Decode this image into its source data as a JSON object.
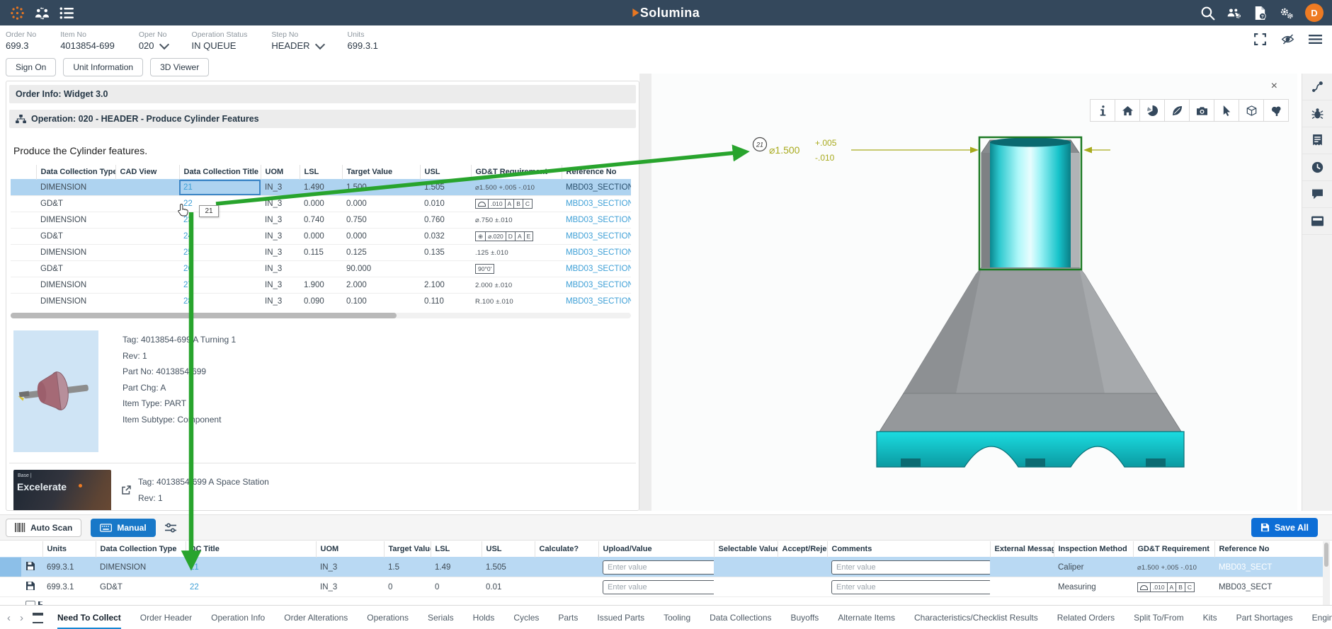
{
  "topbar": {
    "logo_text": "Solumina",
    "avatar_initial": "D",
    "left_icons": [
      "app-launcher-icon",
      "handoff-icon",
      "task-list-icon"
    ],
    "right_icons": [
      "search-icon",
      "user-admin-icon",
      "help-doc-icon",
      "settings-gears-icon"
    ]
  },
  "context_bar": {
    "fields": [
      {
        "label": "Order No",
        "value": "699.3",
        "dropdown": false
      },
      {
        "label": "Item No",
        "value": "4013854-699",
        "dropdown": false
      },
      {
        "label": "Oper No",
        "value": "020",
        "dropdown": true
      },
      {
        "label": "Operation Status",
        "value": "IN QUEUE",
        "dropdown": false
      },
      {
        "label": "Step No",
        "value": "HEADER",
        "dropdown": true
      },
      {
        "label": "Units",
        "value": "699.3.1",
        "dropdown": false
      }
    ],
    "right_icons": [
      "fullscreen-icon",
      "eye-off-icon",
      "menu-icon"
    ]
  },
  "action_buttons": [
    "Sign On",
    "Unit Information",
    "3D Viewer"
  ],
  "left_panel": {
    "order_info_title": "Order Info: Widget 3.0",
    "operation_title": "Operation: 020 - HEADER - Produce Cylinder Features",
    "instruction": "Produce the Cylinder features.",
    "collect_table": {
      "columns": [
        "Data Collection Type",
        "CAD View",
        "Data Collection Title",
        "UOM",
        "LSL",
        "Target Value",
        "USL",
        "GD&T Requirement",
        "Reference No"
      ],
      "rows": [
        {
          "type": "DIMENSION",
          "title": "21",
          "uom": "IN_3",
          "lsl": "1.490",
          "target": "1.500",
          "usl": "1.505",
          "gdt": {
            "text": "⌀1.500  +.005  -.010"
          },
          "ref": "MBD03_SECTION",
          "selected": true
        },
        {
          "type": "GD&T",
          "title": "22",
          "uom": "IN_3",
          "lsl": "0.000",
          "target": "0.000",
          "usl": "0.010",
          "gdt": {
            "frame": [
              "profile-of-surface-symbol",
              ".010",
              "A",
              "B",
              "C"
            ]
          },
          "ref": "MBD03_SECTION",
          "selected": false
        },
        {
          "type": "DIMENSION",
          "title": "23",
          "uom": "IN_3",
          "lsl": "0.740",
          "target": "0.750",
          "usl": "0.760",
          "gdt": {
            "text": "⌀.750  ±.010"
          },
          "ref": "MBD03_SECTION",
          "selected": false
        },
        {
          "type": "GD&T",
          "title": "24",
          "uom": "IN_3",
          "lsl": "0.000",
          "target": "0.000",
          "usl": "0.032",
          "gdt": {
            "frame": [
              "⊕",
              "⌀.020",
              "D",
              "A",
              "E"
            ]
          },
          "ref": "MBD03_SECTION",
          "selected": false
        },
        {
          "type": "DIMENSION",
          "title": "25",
          "uom": "IN_3",
          "lsl": "0.115",
          "target": "0.125",
          "usl": "0.135",
          "gdt": {
            "text": ".125  ±.010"
          },
          "ref": "MBD03_SECTION",
          "selected": false
        },
        {
          "type": "GD&T",
          "title": "26",
          "uom": "IN_3",
          "lsl": "",
          "target": "90.000",
          "usl": "",
          "gdt": {
            "frame": [
              "90°0'"
            ]
          },
          "ref": "MBD03_SECTION",
          "selected": false
        },
        {
          "type": "DIMENSION",
          "title": "27",
          "uom": "IN_3",
          "lsl": "1.900",
          "target": "2.000",
          "usl": "2.100",
          "gdt": {
            "text": "2.000  ±.010"
          },
          "ref": "MBD03_SECTION",
          "selected": false
        },
        {
          "type": "DIMENSION",
          "title": "28",
          "uom": "IN_3",
          "lsl": "0.090",
          "target": "0.100",
          "usl": "0.110",
          "gdt": {
            "text": "R.100  ±.010"
          },
          "ref": "MBD03_SECTION",
          "selected": false
        }
      ]
    },
    "item_card": {
      "lines": [
        "Tag: 4013854-699 A Turning 1",
        "Rev: 1",
        "Part No: 4013854-699",
        "Part Chg: A",
        "Item Type: PART",
        "Item Subtype: Component"
      ]
    },
    "item_card_2": {
      "tag": "Tag: 4013854-699 A Space Station",
      "rev": "Rev: 1",
      "thumb_brand_small": "Base |",
      "thumb_brand": "Excelerate"
    }
  },
  "viewer": {
    "toolbar_icons": [
      "info-icon",
      "home-icon",
      "pie-section-icon",
      "feather-markup-icon",
      "camera-snapshot-icon",
      "select-cursor-icon",
      "cube-model-icon",
      "model-tree-icon"
    ],
    "close_glyph": "×",
    "annotation": {
      "balloon": "21",
      "dimension": "⌀1.500",
      "tol_plus": "+.005",
      "tol_minus": "-.010"
    }
  },
  "right_sidebar_icons": [
    "route-icon",
    "bug-icon",
    "receipt-icon",
    "history-clock-icon",
    "comments-icon",
    "card-panel-icon"
  ],
  "scan_bar": {
    "auto_scan_label": "Auto Scan",
    "manual_label": "Manual",
    "save_all_label": "Save All"
  },
  "entry_table": {
    "columns": [
      "Units",
      "Data Collection Type",
      "DC Title",
      "UOM",
      "Target Value",
      "LSL",
      "USL",
      "Calculate?",
      "Upload/Value",
      "Selectable Value",
      "Accept/Reject",
      "Comments",
      "External Message",
      "Inspection Method",
      "GD&T Requirement",
      "Reference No"
    ],
    "input_placeholder": "Enter value",
    "rows": [
      {
        "units": "699.3.1",
        "type": "DIMENSION",
        "title": "21",
        "uom": "IN_3",
        "target": "1.5",
        "lsl": "1.49",
        "usl": "1.505",
        "method": "Caliper",
        "gdt": {
          "text": "⌀1.500  +.005  -.010"
        },
        "ref": "MBD03_SECT",
        "selected": true
      },
      {
        "units": "699.3.1",
        "type": "GD&T",
        "title": "22",
        "uom": "IN_3",
        "target": "0",
        "lsl": "0",
        "usl": "0.01",
        "method": "Measuring",
        "gdt": {
          "frame": [
            "profile-of-surface-symbol",
            ".010",
            "A",
            "B",
            "C"
          ]
        },
        "ref": "MBD03_SECT",
        "selected": false
      }
    ]
  },
  "tabs": {
    "active": "Need To Collect",
    "items": [
      "Need To Collect",
      "Order Header",
      "Operation Info",
      "Order Alterations",
      "Operations",
      "Serials",
      "Holds",
      "Cycles",
      "Parts",
      "Issued Parts",
      "Tooling",
      "Data Collections",
      "Buyoffs",
      "Alternate Items",
      "Characteristics/Checklist Results",
      "Related Orders",
      "Split To/From",
      "Kits",
      "Part Shortages",
      "Engineering Standards"
    ]
  },
  "annotations": {
    "tooltip_text": "21"
  },
  "colors": {
    "topbar": "#34485c",
    "brand_orange": "#e87722",
    "accent_blue": "#1787d2",
    "link_blue": "#3d9fd6",
    "selected_row": "#aed3f0",
    "green_arrow": "#28a42d",
    "dim_olive": "#a8aa1d",
    "part_cyan": "#12d8de",
    "part_gray": "#9a9da0"
  }
}
